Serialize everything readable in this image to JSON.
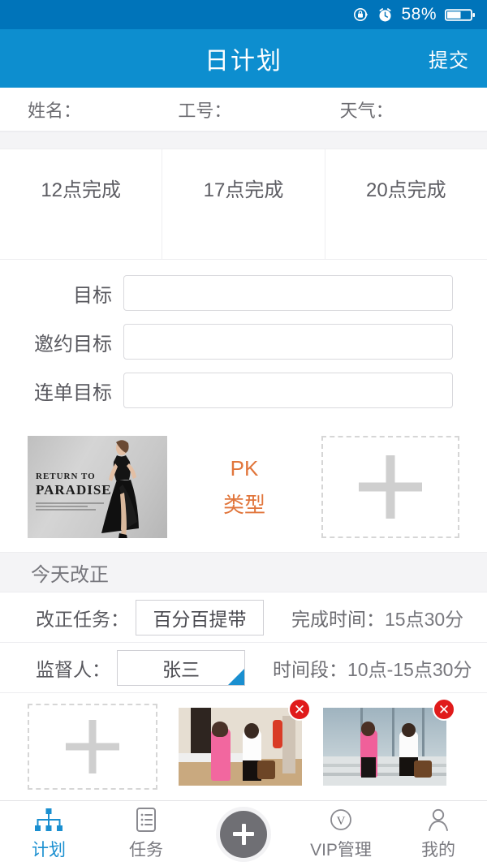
{
  "statusbar": {
    "battery_percent": "58%",
    "icons": [
      "rotation-lock-icon",
      "alarm-clock-icon",
      "battery-icon"
    ]
  },
  "titlebar": {
    "title": "日计划",
    "submit_label": "提交"
  },
  "info_row": {
    "name_label": "姓名：",
    "employee_id_label": "工号：",
    "weather_label": "天气："
  },
  "time_slots": [
    {
      "label": "12点完成"
    },
    {
      "label": "17点完成"
    },
    {
      "label": "20点完成"
    }
  ],
  "goals": [
    {
      "label": "目标",
      "value": "",
      "placeholder": ""
    },
    {
      "label": "邀约目标",
      "value": "",
      "placeholder": ""
    },
    {
      "label": "连单目标",
      "value": "",
      "placeholder": ""
    }
  ],
  "pk_section": {
    "photo_caption_line1": "RETURN TO",
    "photo_caption_line2": "PARADISE",
    "pk_label": "PK",
    "type_label": "类型",
    "add_label": "+",
    "accent_color": "#e1763c"
  },
  "correction": {
    "section_title": "今天改正",
    "rows": [
      {
        "label": "改正任务：",
        "select_value": "百分百提带",
        "right_label": "完成时间：",
        "right_value": "15点30分"
      },
      {
        "label": "监督人：",
        "select_value": "张三",
        "right_label": "时间段：",
        "right_value": "10点-15点30分"
      }
    ]
  },
  "photo_row": {
    "add_label": "+",
    "delete_label": "✕",
    "thumbs": [
      {
        "name": "photo-two-women-indoor"
      },
      {
        "name": "photo-two-women-street"
      }
    ]
  },
  "tabbar": {
    "items": [
      {
        "label": "计划",
        "icon": "org-chart-icon",
        "active": true
      },
      {
        "label": "任务",
        "icon": "list-document-icon",
        "active": false
      },
      {
        "label": "",
        "icon": "plus-fab-icon",
        "active": false
      },
      {
        "label": "VIP管理",
        "icon": "vip-circle-icon",
        "active": false
      },
      {
        "label": "我的",
        "icon": "person-icon",
        "active": false
      }
    ],
    "active_color": "#1a8fd0"
  }
}
